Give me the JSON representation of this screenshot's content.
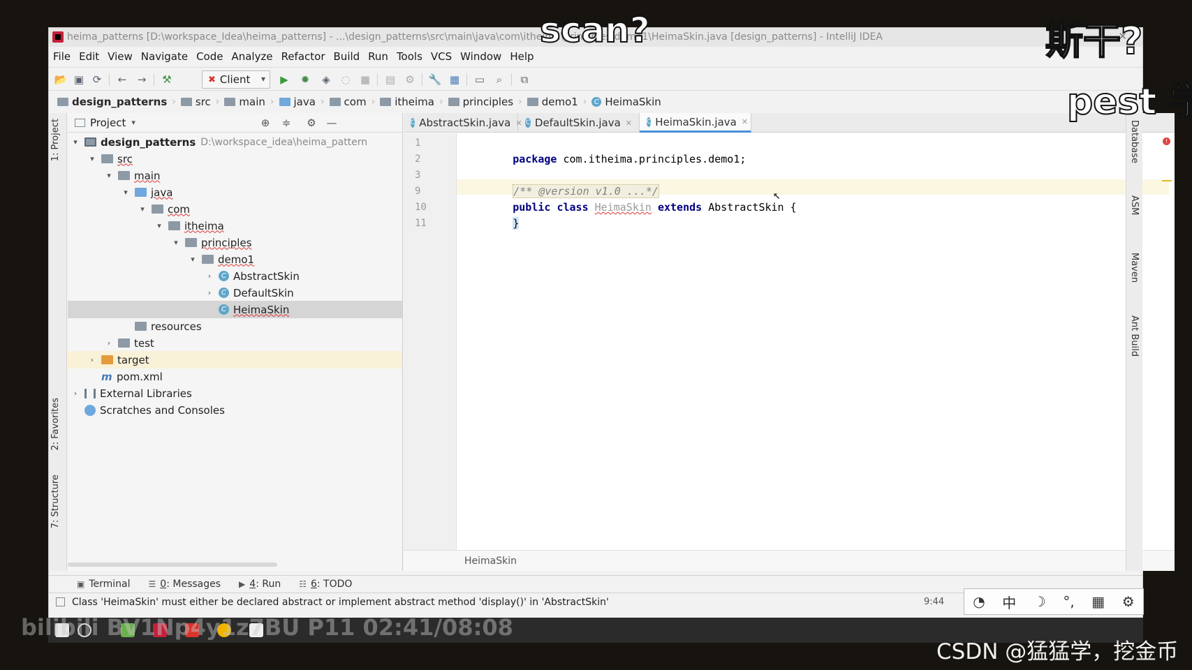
{
  "window": {
    "title": "heima_patterns [D:\\workspace_Idea\\heima_patterns] - ...\\design_patterns\\src\\main\\java\\com\\itheima\\principles\\demo1\\HeimaSkin.java [design_patterns] - IntelliJ IDEA"
  },
  "menu": [
    "File",
    "Edit",
    "View",
    "Navigate",
    "Code",
    "Analyze",
    "Refactor",
    "Build",
    "Run",
    "Tools",
    "VCS",
    "Window",
    "Help"
  ],
  "toolbar": {
    "run_config": "Client"
  },
  "breadcrumb": [
    "design_patterns",
    "src",
    "main",
    "java",
    "com",
    "itheima",
    "principles",
    "demo1",
    "HeimaSkin"
  ],
  "left_strip": {
    "project": "1: Project",
    "favorites": "2: Favorites",
    "structure": "7: Structure"
  },
  "project_panel": {
    "title": "Project",
    "root_name": "design_patterns",
    "root_path": "D:\\workspace_idea\\heima_pattern",
    "nodes": {
      "src": "src",
      "main": "main",
      "java": "java",
      "com": "com",
      "itheima": "itheima",
      "principles": "principles",
      "demo1": "demo1",
      "abstract_skin": "AbstractSkin",
      "default_skin": "DefaultSkin",
      "heima_skin": "HeimaSkin",
      "resources": "resources",
      "test": "test",
      "target": "target",
      "pom": "pom.xml",
      "libraries": "External Libraries",
      "scratches": "Scratches and Consoles"
    }
  },
  "editor": {
    "tabs": [
      "AbstractSkin.java",
      "DefaultSkin.java",
      "HeimaSkin.java"
    ],
    "active_tab": "HeimaSkin.java",
    "line_numbers": [
      "1",
      "2",
      "3",
      "9",
      "10",
      "11"
    ],
    "code": {
      "l1_kw": "package",
      "l1_rest": " com.itheima.principles.demo1;",
      "l3": "/** @version v1.0 ...*/",
      "l9_kw1": "public",
      "l9_kw2": "class",
      "l9_name": "HeimaSkin",
      "l9_kw3": "extends",
      "l9_parent": "AbstractSkin",
      "l9_brace": "{",
      "l10": "}"
    },
    "footer": "HeimaSkin"
  },
  "right_strip": {
    "database": "Database",
    "asm": "ASM",
    "maven": "Maven",
    "ant": "Ant Build"
  },
  "tool_tabs": {
    "terminal": "Terminal",
    "messages_key": "0",
    "messages": ": Messages",
    "run_key": "4",
    "run": ": Run",
    "todo_key": "6",
    "todo": ": TODO"
  },
  "status": {
    "message": "Class 'HeimaSkin' must either be declared abstract or implement abstract method 'display()' in 'AbstractSkin'",
    "position": "9:44"
  },
  "ime": {
    "lang": "中"
  },
  "overlays": {
    "subtitle_1": "scan?",
    "subtitle_2": "斯干?",
    "subtitle_3": "pest 学",
    "video_watermark": "bilibili BV1Np4y1z7BU P11 02:41/08:08",
    "csdn_watermark": "CSDN @猛猛学，挖金币"
  },
  "colors": {
    "keyword": "#000080",
    "tab_accent": "#4a8fd8",
    "error": "#e04545",
    "selection": "#d5d5d5"
  }
}
